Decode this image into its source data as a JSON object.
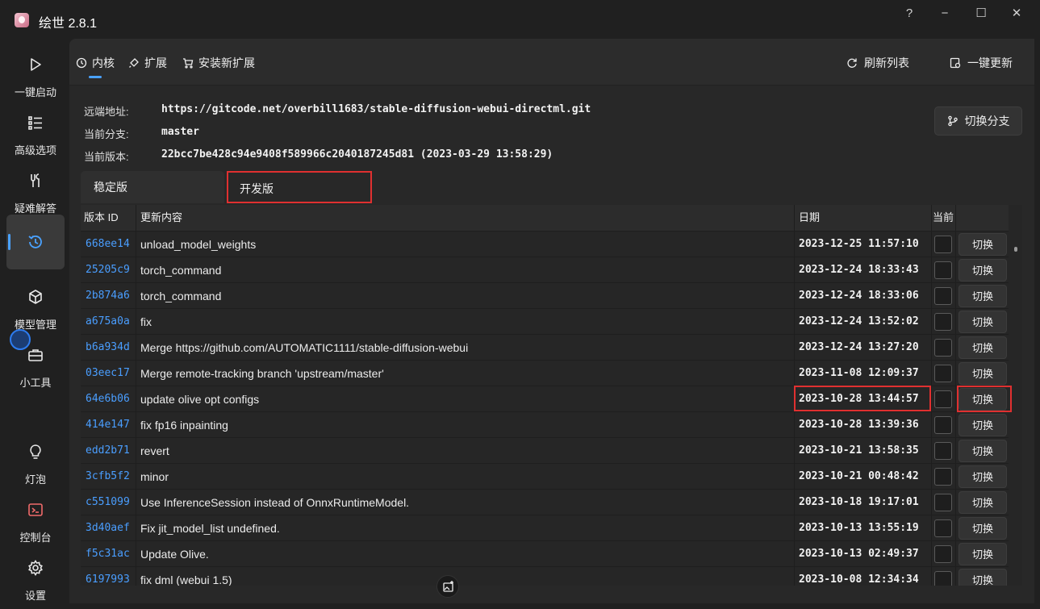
{
  "app": {
    "title": "绘世 2.8.1"
  },
  "window_controls": {
    "help": "?",
    "minimize": "−",
    "maximize": "☐",
    "close": "✕"
  },
  "sidebar": {
    "items": [
      {
        "label": "一键启动",
        "icon": "play-icon"
      },
      {
        "label": "高级选项",
        "icon": "list-icon"
      },
      {
        "label": "疑难解答",
        "icon": "tools-icon"
      },
      {
        "label": "",
        "icon": "history-icon"
      },
      {
        "label": "模型管理",
        "icon": "cube-icon"
      },
      {
        "label": "小工具",
        "icon": "toolbox-icon"
      },
      {
        "label": "灯泡",
        "icon": "lightbulb-icon"
      },
      {
        "label": "控制台",
        "icon": "console-icon"
      },
      {
        "label": "设置",
        "icon": "gear-icon"
      }
    ]
  },
  "tabs": [
    {
      "label": "内核",
      "icon": "clock-icon"
    },
    {
      "label": "扩展",
      "icon": "plug-icon"
    },
    {
      "label": "安装新扩展",
      "icon": "cart-icon"
    }
  ],
  "actions": {
    "refresh": "刷新列表",
    "update_all": "一键更新",
    "switch_branch": "切换分支"
  },
  "repo": {
    "remote_label": "远端地址:",
    "remote_value": "https://gitcode.net/overbill1683/stable-diffusion-webui-directml.git",
    "branch_label": "当前分支:",
    "branch_value": "master",
    "version_label": "当前版本:",
    "version_value": "22bcc7be428c94e9408f589966c2040187245d81 (2023-03-29 13:58:29)"
  },
  "version_tabs": {
    "stable": "稳定版",
    "dev": "开发版"
  },
  "table": {
    "headers": {
      "id": "版本 ID",
      "message": "更新内容",
      "date": "日期",
      "current": "当前"
    },
    "switch_label": "切换",
    "rows": [
      {
        "id": "668ee14",
        "message": "unload_model_weights",
        "date": "2023-12-25 11:57:10"
      },
      {
        "id": "25205c9",
        "message": "torch_command",
        "date": "2023-12-24 18:33:43"
      },
      {
        "id": "2b874a6",
        "message": "torch_command",
        "date": "2023-12-24 18:33:06"
      },
      {
        "id": "a675a0a",
        "message": "fix",
        "date": "2023-12-24 13:52:02"
      },
      {
        "id": "b6a934d",
        "message": "Merge https://github.com/AUTOMATIC1111/stable-diffusion-webui",
        "date": "2023-12-24 13:27:20"
      },
      {
        "id": "03eec17",
        "message": "Merge remote-tracking branch 'upstream/master'",
        "date": "2023-11-08 12:09:37"
      },
      {
        "id": "64e6b06",
        "message": "update olive opt configs",
        "date": "2023-10-28 13:44:57"
      },
      {
        "id": "414e147",
        "message": "fix fp16 inpainting",
        "date": "2023-10-28 13:39:36"
      },
      {
        "id": "edd2b71",
        "message": "revert",
        "date": "2023-10-21 13:58:35"
      },
      {
        "id": "3cfb5f2",
        "message": "minor",
        "date": "2023-10-21 00:48:42"
      },
      {
        "id": "c551099",
        "message": "Use InferenceSession instead of OnnxRuntimeModel.",
        "date": "2023-10-18 19:17:01"
      },
      {
        "id": "3d40aef",
        "message": "Fix jit_model_list undefined.",
        "date": "2023-10-13 13:55:19"
      },
      {
        "id": "f5c31ac",
        "message": "Update Olive.",
        "date": "2023-10-13 02:49:37"
      },
      {
        "id": "6197993",
        "message": "fix dml (webui 1.5)",
        "date": "2023-10-08 12:34:34"
      }
    ]
  }
}
